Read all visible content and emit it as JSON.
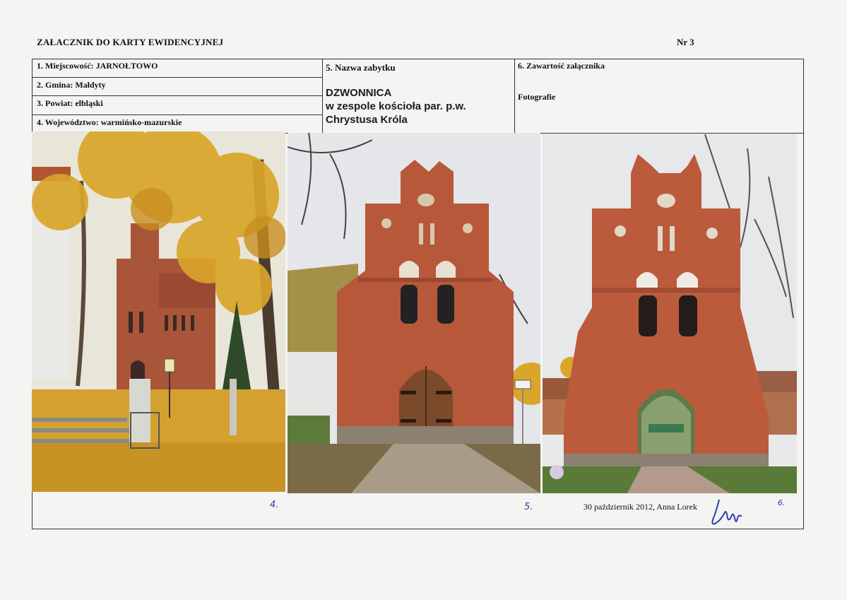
{
  "header": {
    "title": "ZAŁACZNIK DO KARTY EWIDENCYJNEJ",
    "number": "Nr 3"
  },
  "fields": {
    "miejscowosc": "1. Miejscowość: JARNOŁTOWO",
    "gmina": "2. Gmina: Małdyty",
    "powiat": "3. Powiat: elbląski",
    "wojewodztwo": "4. Województwo: warmińsko-mazurskie"
  },
  "monument": {
    "label": "5. Nazwa zabytku",
    "line1": "DZWONNICA",
    "line2": "w zespole kościoła par. p.w.",
    "line3": "Chrystusa Króla"
  },
  "contents": {
    "label": "6. Zawartość załącznika",
    "value": "Fotografie"
  },
  "photo_numbers": [
    "4.",
    "5.",
    "6."
  ],
  "caption": "30 październik 2012, Anna Lorek",
  "colors": {
    "ink_blue": "#2a3fb0",
    "brick": "#b8583a",
    "foliage": "#d9a52a"
  }
}
